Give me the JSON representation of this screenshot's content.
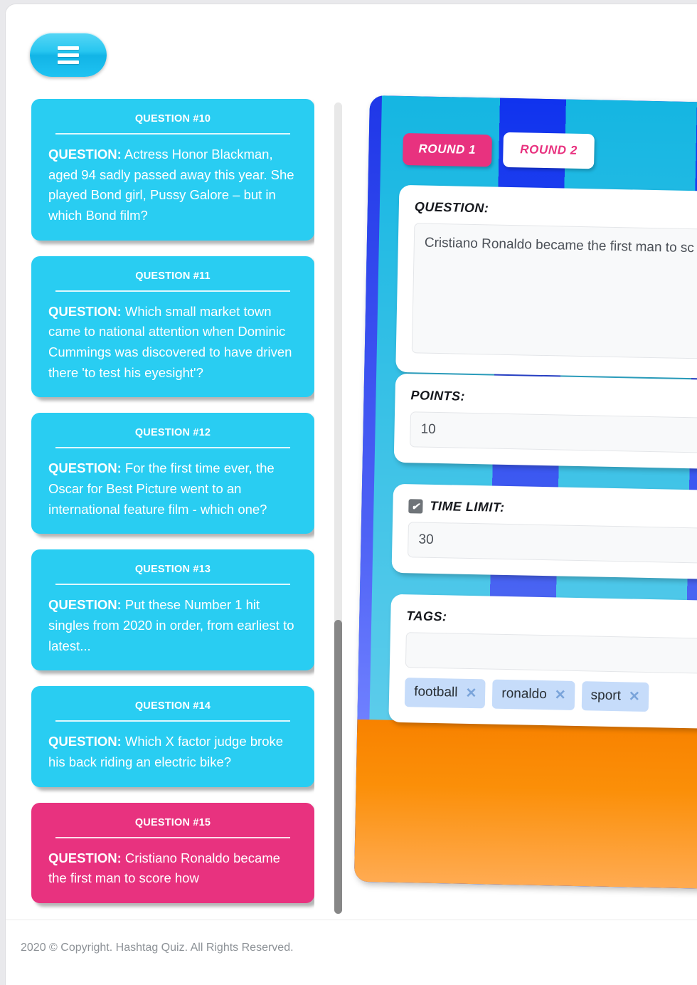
{
  "app": {
    "menu_button_icon": "hamburger-icon"
  },
  "question_list": [
    {
      "title": "QUESTION #10",
      "label": "QUESTION:",
      "text": " Actress Honor Blackman, aged 94 sadly passed away this year. She played Bond girl, Pussy Galore – but in which Bond film?",
      "active": false
    },
    {
      "title": "QUESTION #11",
      "label": "QUESTION:",
      "text": " Which small market town came to national attention when Dominic Cummings was discovered to have driven there 'to test his eyesight'?",
      "active": false
    },
    {
      "title": "QUESTION #12",
      "label": "QUESTION:",
      "text": " For the first time ever, the Oscar for Best Picture went to an international feature film - which one?",
      "active": false
    },
    {
      "title": "QUESTION #13",
      "label": "QUESTION:",
      "text": " Put these Number 1 hit singles from 2020 in order, from earliest to latest...",
      "active": false
    },
    {
      "title": "QUESTION #14",
      "label": "QUESTION:",
      "text": " Which X factor judge broke his back riding an electric bike?",
      "active": false
    },
    {
      "title": "QUESTION #15",
      "label": "QUESTION:",
      "text": " Cristiano Ronaldo became the first man to score how",
      "active": true
    }
  ],
  "editor": {
    "tabs": [
      {
        "label": "ROUND 1",
        "selected": true
      },
      {
        "label": "ROUND 2",
        "selected": false
      }
    ],
    "question_field": {
      "label": "QUESTION:",
      "value": "Cristiano Ronaldo became the first man to sc"
    },
    "points_field": {
      "label": "POINTS:",
      "value": "10"
    },
    "time_limit_field": {
      "label": "TIME LIMIT:",
      "value": "30",
      "checked": true,
      "checkmark": "✔"
    },
    "tags_field": {
      "label": "TAGS:",
      "value": "",
      "remove_glyph": "✕",
      "tags": [
        "football",
        "ronaldo",
        "sport"
      ]
    }
  },
  "footer": {
    "copyright": "2020 © Copyright. Hashtag Quiz. All Rights Reserved."
  },
  "colors": {
    "card_cyan": "#29cdf2",
    "card_pink": "#e8327f",
    "panel_blue": "#1033ee",
    "panel_cyan": "#15b6e2",
    "panel_orange": "#f88200",
    "tag_blue": "#c6dcfa"
  }
}
